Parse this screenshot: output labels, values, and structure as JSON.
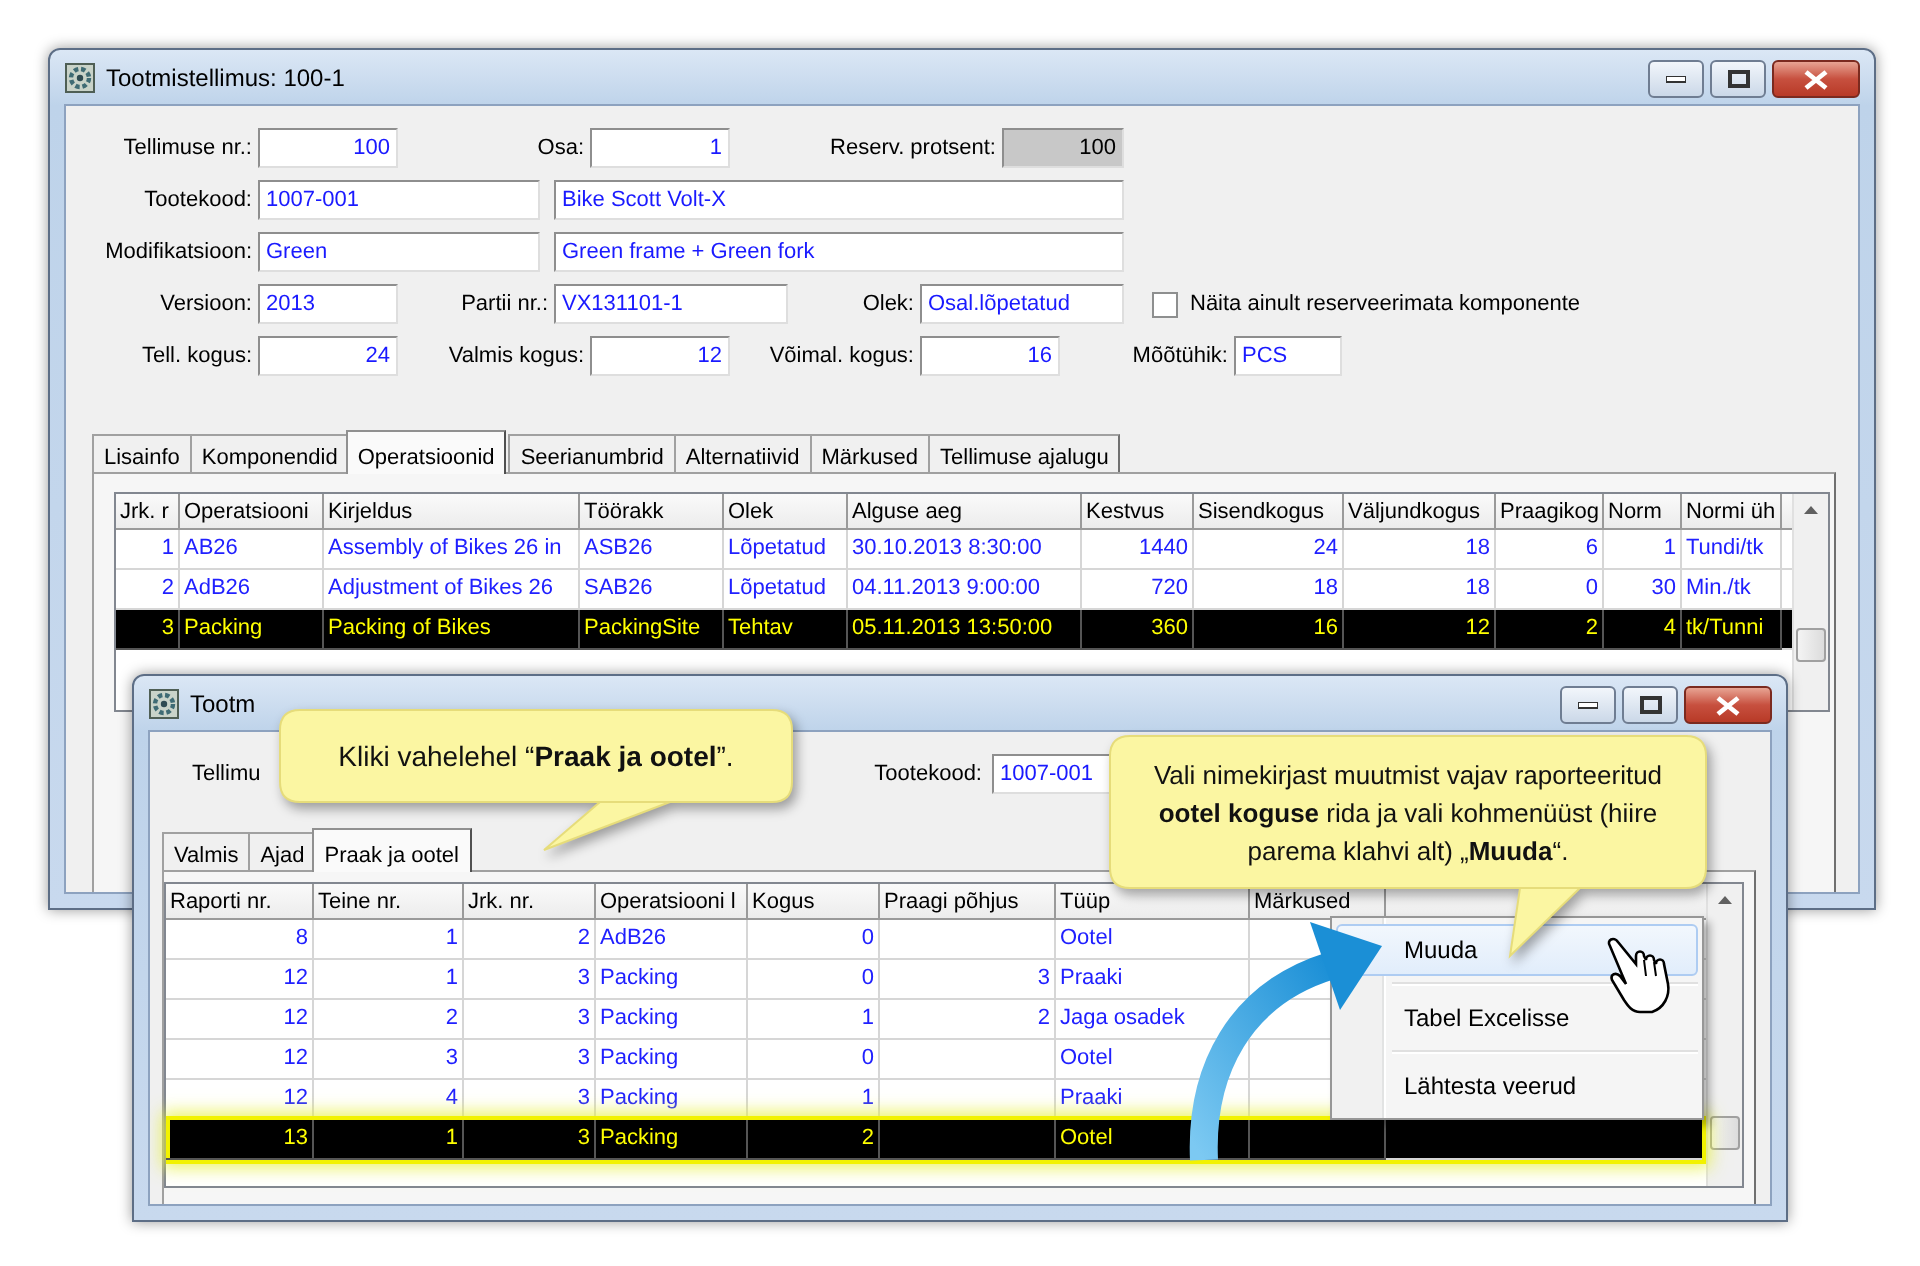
{
  "main_window": {
    "title": "Tootmistellimus: 100-1",
    "form_rows": [
      [
        {
          "kind": "label",
          "text": "Tellimuse nr.:"
        },
        {
          "kind": "number_field",
          "value": "100"
        },
        {
          "kind": "label",
          "text": "Osa:"
        },
        {
          "kind": "number_field",
          "value": "1"
        },
        {
          "kind": "label",
          "text": "Reserv. protsent:"
        },
        {
          "kind": "readonly_field",
          "value": "100"
        }
      ],
      [
        {
          "kind": "label",
          "text": "Tootekood:"
        },
        {
          "kind": "text_field",
          "value": "1007-001"
        },
        {
          "kind": "text_field",
          "value": "Bike Scott Volt-X"
        }
      ],
      [
        {
          "kind": "label",
          "text": "Modifikatsioon:"
        },
        {
          "kind": "text_field",
          "value": "Green"
        },
        {
          "kind": "text_field",
          "value": "Green frame + Green fork"
        }
      ],
      [
        {
          "kind": "label",
          "text": "Versioon:"
        },
        {
          "kind": "text_field",
          "value": "2013"
        },
        {
          "kind": "label",
          "text": "Partii nr.:"
        },
        {
          "kind": "text_field",
          "value": "VX131101-1"
        },
        {
          "kind": "label",
          "text": "Olek:"
        },
        {
          "kind": "text_field",
          "value": "Osal.lõpetatud"
        },
        {
          "kind": "checkbox",
          "label": "Näita ainult reserveerimata komponente",
          "checked": false
        }
      ],
      [
        {
          "kind": "label",
          "text": "Tell. kogus:"
        },
        {
          "kind": "number_field",
          "value": "24"
        },
        {
          "kind": "label",
          "text": "Valmis kogus:"
        },
        {
          "kind": "number_field",
          "value": "12"
        },
        {
          "kind": "label",
          "text": "Võimal. kogus:"
        },
        {
          "kind": "number_field",
          "value": "16"
        },
        {
          "kind": "label",
          "text": "Mõõtühik:"
        },
        {
          "kind": "text_field",
          "value": "PCS"
        }
      ]
    ],
    "tabs": [
      {
        "label": "Lisainfo",
        "selected": false
      },
      {
        "label": "Komponendid",
        "selected": false
      },
      {
        "label": "Operatsioonid",
        "selected": true
      },
      {
        "label": "Seerianumbrid",
        "selected": false
      },
      {
        "label": "Alternatiivid",
        "selected": false
      },
      {
        "label": "Märkused",
        "selected": false
      },
      {
        "label": "Tellimuse ajalugu",
        "selected": false
      }
    ],
    "table": {
      "columns": [
        {
          "label": "Jrk. r",
          "kind": "number"
        },
        {
          "label": "Operatsiooni",
          "kind": "text"
        },
        {
          "label": "Kirjeldus",
          "kind": "text"
        },
        {
          "label": "Töörakk",
          "kind": "text"
        },
        {
          "label": "Olek",
          "kind": "text"
        },
        {
          "label": "Alguse aeg",
          "kind": "text"
        },
        {
          "label": "Kestvus",
          "kind": "number"
        },
        {
          "label": "Sisendkogus",
          "kind": "number"
        },
        {
          "label": "Väljundkogus",
          "kind": "number"
        },
        {
          "label": "Praagikog",
          "kind": "number"
        },
        {
          "label": "Norm",
          "kind": "number"
        },
        {
          "label": "Normi üh",
          "kind": "text"
        }
      ],
      "rows": [
        {
          "cells": [
            "1",
            "AB26",
            "Assembly of Bikes 26 in",
            "ASB26",
            "Lõpetatud",
            "30.10.2013 8:30:00",
            "1440",
            "24",
            "18",
            "6",
            "1",
            "Tundi/tk"
          ],
          "selected": false
        },
        {
          "cells": [
            "2",
            "AdB26",
            "Adjustment of Bikes 26",
            "SAB26",
            "Lõpetatud",
            "04.11.2013 9:00:00",
            "720",
            "18",
            "18",
            "0",
            "30",
            "Min./tk"
          ],
          "selected": false
        },
        {
          "cells": [
            "3",
            "Packing",
            "Packing of Bikes",
            "PackingSite",
            "Tehtav",
            "05.11.2013 13:50:00",
            "360",
            "16",
            "12",
            "2",
            "4",
            "tk/Tunni"
          ],
          "selected": true
        }
      ]
    }
  },
  "report_window": {
    "title": "Tootm",
    "form": [
      {
        "kind": "label",
        "text": "Tellimu"
      },
      {
        "kind": "label",
        "text": "Tootekood:"
      },
      {
        "kind": "text_field",
        "value": "1007-001"
      }
    ],
    "tabs": [
      {
        "label": "Valmis",
        "selected": false
      },
      {
        "label": "Ajad",
        "selected": false
      },
      {
        "label": "Praak ja ootel",
        "selected": true
      }
    ],
    "table": {
      "columns": [
        {
          "label": "Raporti nr.",
          "kind": "number"
        },
        {
          "label": "Teine nr.",
          "kind": "number"
        },
        {
          "label": "Jrk. nr.",
          "kind": "number"
        },
        {
          "label": "Operatsiooni l",
          "kind": "text"
        },
        {
          "label": "Kogus",
          "kind": "number"
        },
        {
          "label": "Praagi põhjus",
          "kind": "number"
        },
        {
          "label": "Tüüp",
          "kind": "text"
        },
        {
          "label": "Märkused",
          "kind": "text"
        }
      ],
      "rows": [
        {
          "cells": [
            "8",
            "1",
            "2",
            "AdB26",
            "0",
            null,
            "Ootel",
            null
          ],
          "selected": false
        },
        {
          "cells": [
            "12",
            "1",
            "3",
            "Packing",
            "0",
            "3",
            "Praaki",
            null
          ],
          "selected": false
        },
        {
          "cells": [
            "12",
            "2",
            "3",
            "Packing",
            "1",
            "2",
            "Jaga osadek",
            null
          ],
          "selected": false
        },
        {
          "cells": [
            "12",
            "3",
            "3",
            "Packing",
            "0",
            null,
            "Ootel",
            null
          ],
          "selected": false
        },
        {
          "cells": [
            "12",
            "4",
            "3",
            "Packing",
            "1",
            null,
            "Praaki",
            null
          ],
          "selected": false
        },
        {
          "cells": [
            "13",
            "1",
            "3",
            "Packing",
            "2",
            null,
            "Ootel",
            null
          ],
          "selected": true
        }
      ]
    }
  },
  "context_menu": {
    "items": [
      {
        "label": "Muuda",
        "selected": true
      },
      {
        "label": "Tabel Excelisse",
        "selected": false
      },
      {
        "label": "Lähtesta veerud",
        "selected": false
      }
    ]
  },
  "callouts": [
    {
      "text": "Kliki vahelehel “**Praak ja ootel**”."
    },
    {
      "text": "Vali nimekirjast muutmist vajav raporteeritud **ootel koguse** rida ja vali kohmenüüst (hiire parema klahvi alt) „**Muuda**“."
    }
  ]
}
